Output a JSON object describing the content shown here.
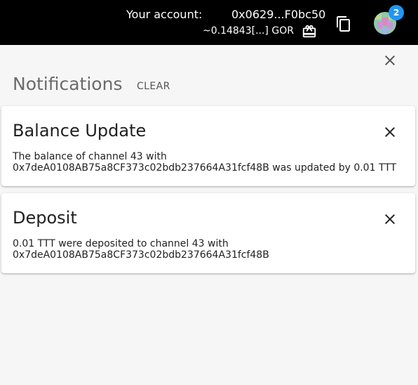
{
  "header": {
    "account_label": "Your account:",
    "account_address": "0x0629...F0bc50",
    "balance": "~0.14843[...] GOR",
    "icons": {
      "gift": "gift-icon",
      "copy": "copy-icon",
      "avatar": "identicon-avatar"
    },
    "notification_count": "2",
    "colors": {
      "background": "#000000",
      "badge": "#2196f3"
    }
  },
  "notifications_panel": {
    "title": "Notifications",
    "clear_label": "CLEAR",
    "close_icon": "close-icon",
    "items": [
      {
        "title": "Balance Update",
        "line1": "The balance of channel 43 with",
        "line2": "0x7deA0108AB75a8CF373c02bdb237664A31fcf48B was updated by 0.01 TTT"
      },
      {
        "title": "Deposit",
        "line1": "0.01 TTT were deposited to channel 43 with",
        "line2": "0x7deA0108AB75a8CF373c02bdb237664A31fcf48B"
      }
    ]
  }
}
